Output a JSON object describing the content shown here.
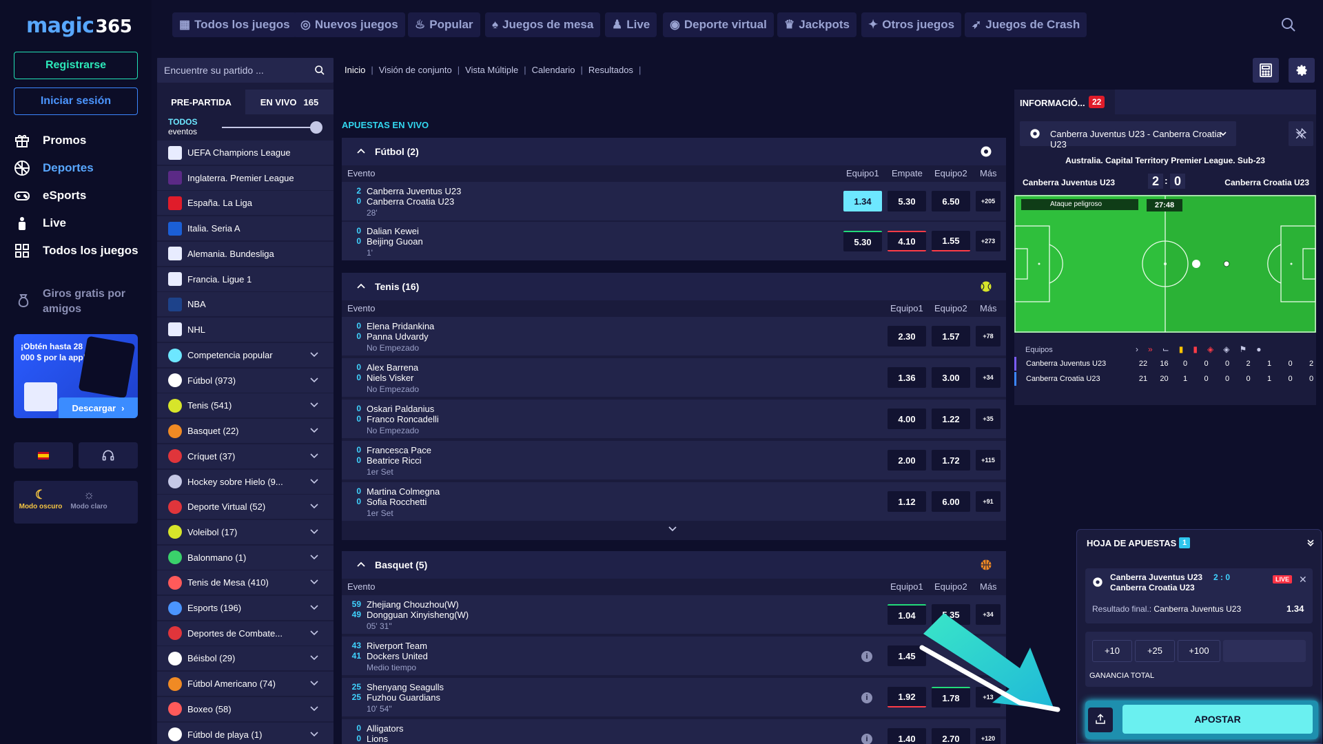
{
  "brand": {
    "logo_text": "magic",
    "logo_num": "365"
  },
  "auth": {
    "register": "Registrarse",
    "login": "Iniciar sesión"
  },
  "nav": [
    {
      "label": "Promos",
      "icon": "gift-icon"
    },
    {
      "label": "Deportes",
      "icon": "ball-icon",
      "active": true
    },
    {
      "label": "eSports",
      "icon": "gamepad-icon"
    },
    {
      "label": "Live",
      "icon": "live-icon"
    },
    {
      "label": "Todos los juegos",
      "icon": "grid-icon"
    }
  ],
  "referral": {
    "label": "Giros gratis por amigos"
  },
  "banner": {
    "text": "¡Obtén hasta 28 000 $ por la app!",
    "cta": "Descargar"
  },
  "modes": {
    "dark": "Modo oscuro",
    "light": "Modo claro"
  },
  "topnav": [
    {
      "label": "Todos los juegos"
    },
    {
      "label": "Nuevos juegos"
    },
    {
      "label": "Popular"
    },
    {
      "label": "Juegos de mesa"
    },
    {
      "label": "Live"
    },
    {
      "label": "Deporte virtual"
    },
    {
      "label": "Jackpots"
    },
    {
      "label": "Otros juegos"
    },
    {
      "label": "Juegos de Crash"
    }
  ],
  "sidebar": {
    "search_placeholder": "Encuentre su partido ...",
    "tab_prematch": "PRE-PARTIDA",
    "tab_live": "EN VIVO",
    "live_count": "165",
    "todos": "TODOS",
    "eventos": "eventos",
    "leagues": [
      {
        "label": "UEFA Champions League"
      },
      {
        "label": "Inglaterra. Premier League"
      },
      {
        "label": "España. La Liga"
      },
      {
        "label": "Italia. Seria A"
      },
      {
        "label": "Alemania. Bundesliga"
      },
      {
        "label": "Francia. Ligue 1"
      },
      {
        "label": "NBA"
      },
      {
        "label": "NHL"
      }
    ],
    "sports": [
      {
        "label": "Competencia popular"
      },
      {
        "label": "Fútbol (973)"
      },
      {
        "label": "Tenis (541)"
      },
      {
        "label": "Basquet (22)"
      },
      {
        "label": "Críquet (37)"
      },
      {
        "label": "Hockey sobre Hielo (9..."
      },
      {
        "label": "Deporte Virtual (52)"
      },
      {
        "label": "Voleibol (17)"
      },
      {
        "label": "Balonmano (1)"
      },
      {
        "label": "Tenis de Mesa (410)"
      },
      {
        "label": "Esports (196)"
      },
      {
        "label": "Deportes de Combate..."
      },
      {
        "label": "Béisbol (29)"
      },
      {
        "label": "Fútbol Americano (74)"
      },
      {
        "label": "Boxeo (58)"
      },
      {
        "label": "Fútbol de playa (1)"
      }
    ]
  },
  "breadcrumbs": [
    "Inicio",
    "Visión de conjunto",
    "Vista Múltiple",
    "Calendario",
    "Resultados"
  ],
  "live_title": "APUESTAS EN VIVO",
  "sections": {
    "futbol": {
      "title": "Fútbol  (2)",
      "cols": {
        "evento": "Evento",
        "c1": "Equipo1",
        "c2": "Empate",
        "c3": "Equipo2",
        "c4": "Más"
      },
      "events": [
        {
          "s1": "2",
          "s2": "0",
          "t1": "Canberra Juventus U23",
          "t2": "Canberra Croatia U23",
          "status": "28'",
          "o1": "1.34",
          "o2": "5.30",
          "o3": "6.50",
          "more": "+205"
        },
        {
          "s1": "0",
          "s2": "0",
          "t1": "Dalian Kewei",
          "t2": "Beijing Guoan",
          "status": "1'",
          "o1": "5.30",
          "o2": "4.10",
          "o3": "1.55",
          "more": "+273"
        }
      ]
    },
    "tenis": {
      "title": "Tenis  (16)",
      "cols": {
        "evento": "Evento",
        "c1": "Equipo1",
        "c3": "Equipo2",
        "c4": "Más"
      },
      "events": [
        {
          "s1": "0",
          "s2": "0",
          "t1": "Elena Pridankina",
          "t2": "Panna Udvardy",
          "status": "No Empezado",
          "o1": "2.30",
          "o3": "1.57",
          "more": "+78"
        },
        {
          "s1": "0",
          "s2": "0",
          "t1": "Alex Barrena",
          "t2": "Niels Visker",
          "status": "No Empezado",
          "o1": "1.36",
          "o3": "3.00",
          "more": "+34"
        },
        {
          "s1": "0",
          "s2": "0",
          "t1": "Oskari Paldanius",
          "t2": "Franco Roncadelli",
          "status": "No Empezado",
          "o1": "4.00",
          "o3": "1.22",
          "more": "+35"
        },
        {
          "s1": "0",
          "s2": "0",
          "t1": "Francesca Pace",
          "t2": "Beatrice Ricci",
          "status": "1er Set",
          "o1": "2.00",
          "o3": "1.72",
          "more": "+115"
        },
        {
          "s1": "0",
          "s2": "0",
          "t1": "Martina Colmegna",
          "t2": "Sofia Rocchetti",
          "status": "1er Set",
          "o1": "1.12",
          "o3": "6.00",
          "more": "+91"
        }
      ]
    },
    "basquet": {
      "title": "Basquet  (5)",
      "cols": {
        "evento": "Evento",
        "c1": "Equipo1",
        "c3": "Equipo2",
        "c4": "Más"
      },
      "events": [
        {
          "s1": "59",
          "s2": "49",
          "t1": "Zhejiang Chouzhou(W)",
          "t2": "Dongguan Xinyisheng(W)",
          "status": "05' 31\"",
          "o1": "1.04",
          "o3": "5.35",
          "more": "+34"
        },
        {
          "s1": "43",
          "s2": "41",
          "t1": "Riverport Team",
          "t2": "Dockers United",
          "status": "Medio tiempo",
          "o1": "1.45",
          "o3": "",
          "more": ""
        },
        {
          "s1": "25",
          "s2": "25",
          "t1": "Shenyang Seagulls",
          "t2": "Fuzhou Guardians",
          "status": "10' 54\"",
          "o1": "1.92",
          "o3": "1.78",
          "more": "+13"
        },
        {
          "s1": "0",
          "s2": "0",
          "t1": "Alligators",
          "t2": "Lions",
          "status": "",
          "o1": "1.40",
          "o3": "2.70",
          "more": "+120"
        }
      ]
    }
  },
  "info": {
    "tab": "INFORMACIÓ...",
    "badge": "22",
    "match_select": "Canberra Juventus U23 - Canberra Croatia U23",
    "league": "Australia. Capital Territory Premier League. Sub-23",
    "home": "Canberra Juventus U23",
    "away": "Canberra Croatia U23",
    "score_home": "2",
    "score_away": "0",
    "attack_label": "Ataque peligroso",
    "clock": "27:48",
    "stats_header": "Equipos",
    "stats": [
      {
        "team": "Canberra Juventus U23",
        "vals": [
          "22",
          "16",
          "0",
          "0",
          "0",
          "2",
          "1",
          "0",
          "2"
        ]
      },
      {
        "team": "Canberra Croatia U23",
        "vals": [
          "21",
          "20",
          "1",
          "0",
          "0",
          "0",
          "1",
          "0",
          "0"
        ]
      }
    ]
  },
  "betslip": {
    "title": "HOJA DE APUESTAS",
    "count": "1",
    "t1": "Canberra Juventus U23",
    "t2": "Canberra Croatia U23",
    "score": "2 : 0",
    "live": "LIVE",
    "market": "Resultado final.:",
    "selection": "Canberra Juventus U23",
    "odd": "1.34",
    "q1": "+10",
    "q2": "+25",
    "q3": "+100",
    "gain": "GANANCIA TOTAL",
    "bet": "APOSTAR"
  },
  "colors": {
    "accent": "#6de7ff",
    "green": "#2ce8b9",
    "blue": "#4b95ff",
    "live_red": "#ff3345"
  }
}
